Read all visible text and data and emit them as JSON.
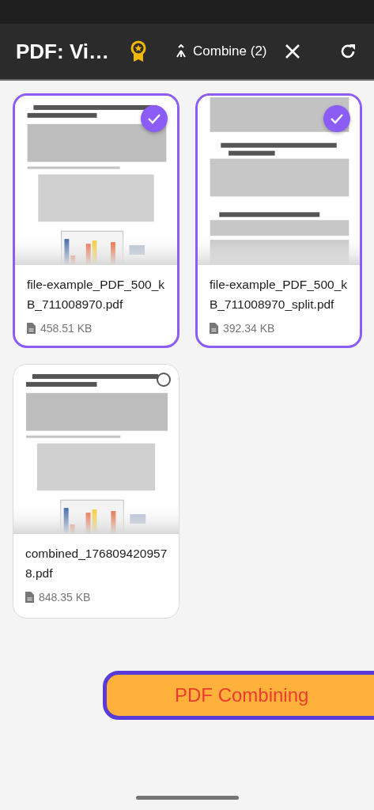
{
  "app_bar": {
    "title": "PDF: Vi…",
    "combine_button": "Combine (2)"
  },
  "files": [
    {
      "name": "file-example_PDF_500_kB_711008970.pdf",
      "size": "458.51 KB",
      "selected": true
    },
    {
      "name": "file-example_PDF_500_kB_711008970_split.pdf",
      "size": "392.34 KB",
      "selected": true
    },
    {
      "name": "combined_1768094209578.pdf",
      "size": "848.35 KB",
      "selected": false
    }
  ],
  "action_button": "PDF Combining"
}
